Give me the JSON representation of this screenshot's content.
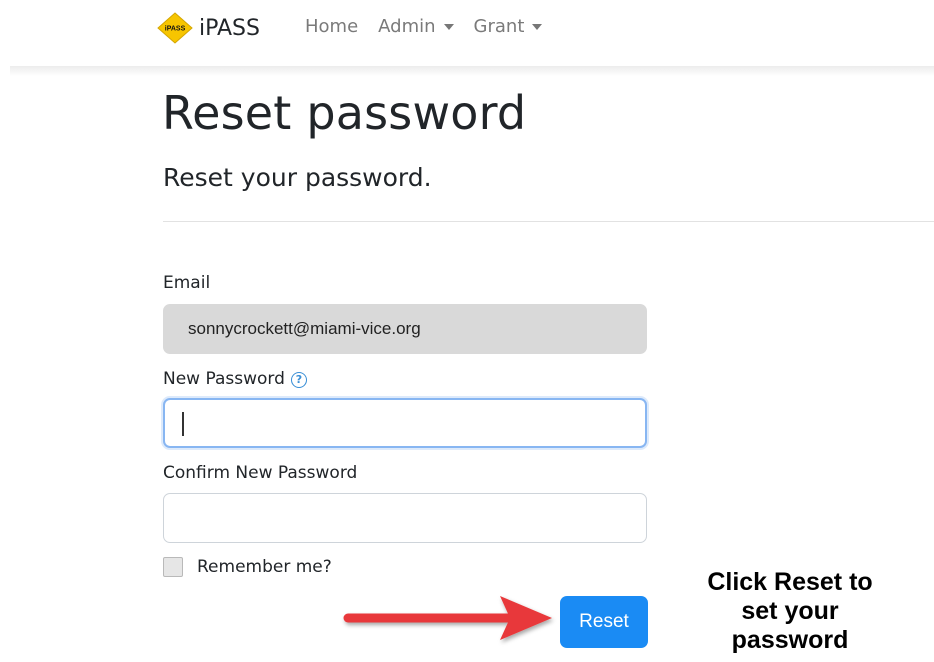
{
  "navbar": {
    "brand": {
      "logo_text": "iPASS",
      "name": "iPASS"
    },
    "links": [
      {
        "label": "Home",
        "dropdown": false
      },
      {
        "label": "Admin",
        "dropdown": true
      },
      {
        "label": "Grant",
        "dropdown": true
      }
    ]
  },
  "page": {
    "title": "Reset password",
    "subtitle": "Reset your password."
  },
  "form": {
    "email": {
      "label": "Email",
      "value": "sonnycrockett@miami-vice.org"
    },
    "new_password": {
      "label": "New Password",
      "help_icon": "?",
      "value": ""
    },
    "confirm_password": {
      "label": "Confirm New Password",
      "value": ""
    },
    "remember_me": {
      "label": "Remember me?",
      "checked": false
    },
    "submit_label": "Reset"
  },
  "annotation": {
    "lines": [
      "Click Reset to",
      "set your",
      "password"
    ],
    "arrow_color": "#e8383a"
  },
  "colors": {
    "primary_button": "#1a8bf4",
    "logo_yellow": "#f7c500",
    "focus_border": "#88b6f2",
    "disabled_field": "#d9d9d9"
  }
}
